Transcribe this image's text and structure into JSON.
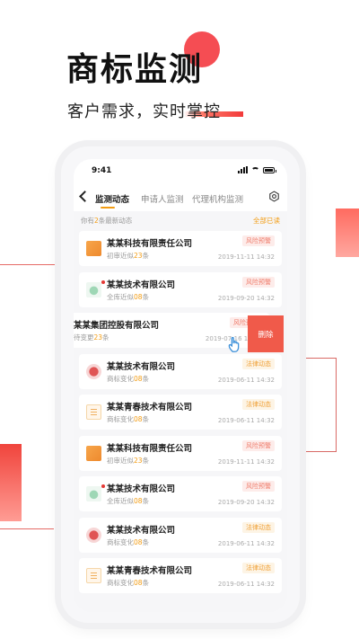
{
  "promo": {
    "title": "商标监测",
    "subtitle": "客户需求，实时掌控"
  },
  "status_bar": {
    "time": "9:41"
  },
  "nav": {
    "tabs": [
      "监测动态",
      "申请人监测",
      "代理机构监测"
    ],
    "active_tab": 0
  },
  "summary": {
    "prefix": "你有",
    "count": "2",
    "suffix": "条最新动态",
    "mark_read": "全部已读"
  },
  "delete_label": "删除",
  "cards": [
    {
      "company": "某某科技有限责任公司",
      "sub_prefix": "初审近似",
      "sub_count": "23",
      "sub_suffix": "条",
      "badge": "风险预警",
      "badge_type": "risk",
      "date": "2019-11-11 14:32",
      "logo": "orange",
      "new": false
    },
    {
      "company": "某某技术有限公司",
      "sub_prefix": "全库近似",
      "sub_count": "08",
      "sub_suffix": "条",
      "badge": "风险预警",
      "badge_type": "risk",
      "date": "2019-09-20 14:32",
      "logo": "green",
      "new": true
    },
    {
      "company": "某某集团控股有限公司",
      "sub_prefix": "待变更",
      "sub_count": "23",
      "sub_suffix": "条",
      "badge": "风险预警",
      "badge_type": "risk",
      "date": "2019-07-16 14:32",
      "logo": "none",
      "new": false
    },
    {
      "company": "某某技术有限公司",
      "sub_prefix": "商标变化",
      "sub_count": "08",
      "sub_suffix": "条",
      "badge": "法律动态",
      "badge_type": "law",
      "date": "2019-06-11 14:32",
      "logo": "red",
      "new": false
    },
    {
      "company": "某某青春技术有限公司",
      "sub_prefix": "商标变化",
      "sub_count": "08",
      "sub_suffix": "条",
      "badge": "法律动态",
      "badge_type": "law",
      "date": "2019-06-11 14:32",
      "logo": "doc",
      "new": false
    },
    {
      "company": "某某科技有限责任公司",
      "sub_prefix": "初审近似",
      "sub_count": "23",
      "sub_suffix": "条",
      "badge": "风险预警",
      "badge_type": "risk",
      "date": "2019-11-11 14:32",
      "logo": "orange",
      "new": false
    },
    {
      "company": "某某技术有限公司",
      "sub_prefix": "全库近似",
      "sub_count": "08",
      "sub_suffix": "条",
      "badge": "风险预警",
      "badge_type": "risk",
      "date": "2019-09-20 14:32",
      "logo": "green",
      "new": true
    },
    {
      "company": "某某技术有限公司",
      "sub_prefix": "商标变化",
      "sub_count": "08",
      "sub_suffix": "条",
      "badge": "法律动态",
      "badge_type": "law",
      "date": "2019-06-11 14:32",
      "logo": "red",
      "new": false
    },
    {
      "company": "某某青春技术有限公司",
      "sub_prefix": "商标变化",
      "sub_count": "08",
      "sub_suffix": "条",
      "badge": "法律动态",
      "badge_type": "law",
      "date": "2019-06-11 14:32",
      "logo": "doc",
      "new": false
    }
  ],
  "colors": {
    "accent": "#f39c12",
    "brand_red": "#f4434a",
    "delete_red": "#f05a4a"
  }
}
